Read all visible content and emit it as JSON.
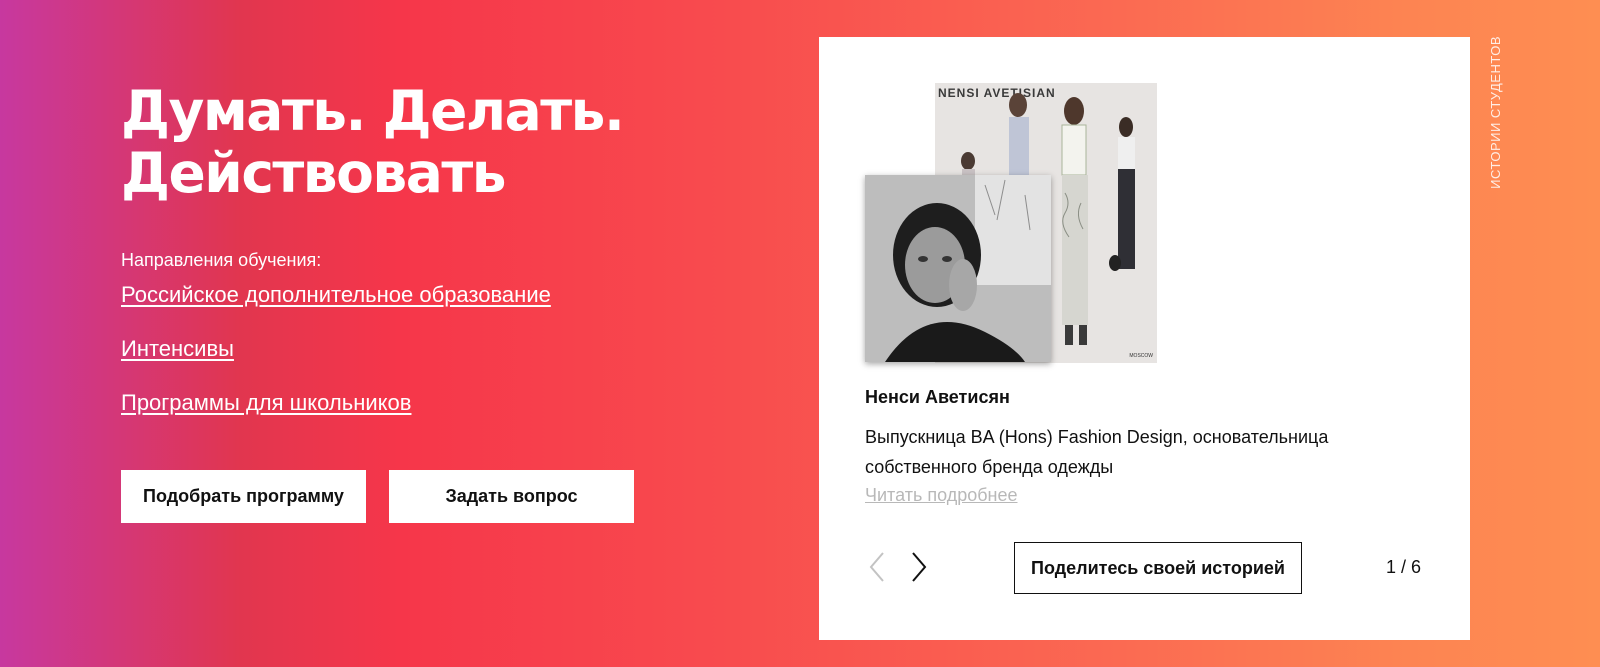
{
  "hero": {
    "title_line1": "Думать. Делать.",
    "title_line2": "Действовать"
  },
  "directions": {
    "label": "Направления обучения:",
    "links": [
      "Российское дополнительное образование",
      "Интенсивы",
      "Программы для школьников"
    ]
  },
  "buttons": {
    "pick_program": "Подобрать программу",
    "ask_question": "Задать вопрос"
  },
  "story_card": {
    "brand_text": "NENSI AVETISIAN",
    "moscow_text": "MOSCOW",
    "name": "Ненси Аветисян",
    "description": "Выпускница BA (Hons) Fashion Design, основательница собственного бренда одежды",
    "read_more": "Читать подробнее",
    "share_button": "Поделитесь своей историей",
    "counter": "1 / 6",
    "prev_icon": "chevron-left-icon",
    "next_icon": "chevron-right-icon"
  },
  "side_label": "ИСТОРИИ СТУДЕНТОВ",
  "colors": {
    "gradient_start": "#c7389f",
    "gradient_mid": "#f6364a",
    "gradient_end": "#fe8e52",
    "read_more": "#b8b8b8"
  }
}
